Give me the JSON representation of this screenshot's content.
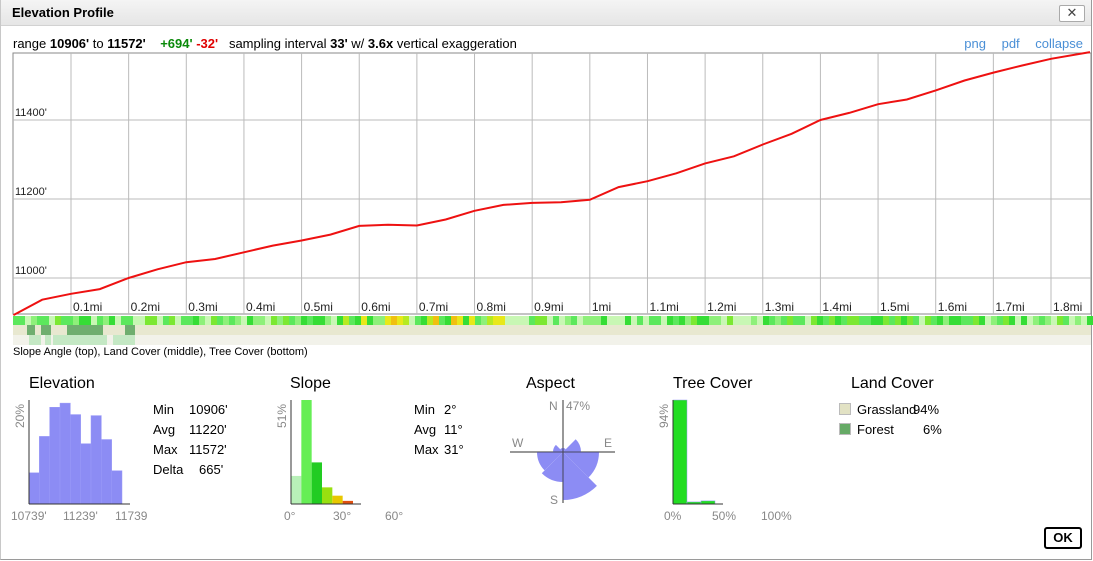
{
  "window": {
    "title": "Elevation Profile",
    "close_glyph": "✕"
  },
  "info": {
    "range_label": "range",
    "range_min": "10906'",
    "to_label": "to",
    "range_max": "11572'",
    "gain": "+694'",
    "loss": "-32'",
    "sampling_label": "sampling interval",
    "sampling_value": "33'",
    "w_label": "w/",
    "exaggeration": "3.6x",
    "exag_label": "vertical exaggeration"
  },
  "links": {
    "png": "png",
    "pdf": "pdf",
    "collapse": "collapse"
  },
  "profile": {
    "y_ticks": [
      "11400'",
      "11200'",
      "11000'"
    ],
    "x_ticks": [
      "0.1mi",
      "0.2mi",
      "0.3mi",
      "0.4mi",
      "0.5mi",
      "0.6mi",
      "0.7mi",
      "0.8mi",
      "0.9mi",
      "1mi",
      "1.1mi",
      "1.2mi",
      "1.3mi",
      "1.4mi",
      "1.5mi",
      "1.6mi",
      "1.7mi",
      "1.8mi"
    ],
    "line_color": "#ee1111",
    "distance_mi": [
      0,
      0.05,
      0.1,
      0.15,
      0.2,
      0.25,
      0.3,
      0.35,
      0.4,
      0.45,
      0.5,
      0.55,
      0.6,
      0.65,
      0.7,
      0.75,
      0.8,
      0.85,
      0.9,
      0.95,
      1.0,
      1.05,
      1.1,
      1.15,
      1.2,
      1.25,
      1.3,
      1.35,
      1.4,
      1.45,
      1.5,
      1.55,
      1.6,
      1.65,
      1.7,
      1.75,
      1.8,
      1.87
    ],
    "elevation_ft": [
      10906,
      10945,
      10960,
      10972,
      11000,
      11022,
      11040,
      11048,
      11065,
      11082,
      11095,
      11110,
      11132,
      11135,
      11133,
      11148,
      11170,
      11185,
      11190,
      11192,
      11198,
      11230,
      11245,
      11265,
      11290,
      11308,
      11338,
      11365,
      11400,
      11418,
      11440,
      11452,
      11475,
      11500,
      11520,
      11538,
      11555,
      11572
    ]
  },
  "slope_bar_caption": "Slope Angle (top), Land Cover (middle), Tree Cover (bottom)",
  "elevation_panel": {
    "title": "Elevation",
    "y_label": "20%",
    "x_ticks": [
      "10739'",
      "11239'",
      "11739"
    ],
    "bar_color": "#8c8cf4",
    "bins": [
      0.3,
      0.65,
      0.93,
      0.97,
      0.86,
      0.58,
      0.85,
      0.62,
      0.32
    ],
    "stats": [
      {
        "k": "Min",
        "v": "10906'"
      },
      {
        "k": "Avg",
        "v": "11220'"
      },
      {
        "k": "Max",
        "v": "11572'"
      },
      {
        "k": "Delta",
        "v": "665'"
      }
    ]
  },
  "slope_panel": {
    "title": "Slope",
    "y_label": "51%",
    "x_ticks": [
      "0°",
      "30°",
      "60°"
    ],
    "bins": [
      0.27,
      1.0,
      0.4,
      0.16,
      0.08,
      0.03
    ],
    "bin_colors": [
      "#b8f0b8",
      "#66ee55",
      "#22cc22",
      "#99e010",
      "#e8c800",
      "#e05010"
    ],
    "stats": [
      {
        "k": "Min",
        "v": "2°"
      },
      {
        "k": "Avg",
        "v": "11°"
      },
      {
        "k": "Max",
        "v": "31°"
      }
    ]
  },
  "aspect_panel": {
    "title": "Aspect",
    "n_label": "N",
    "pct_label": "47%",
    "e_label": "E",
    "w_label": "W",
    "s_label": "S",
    "fill_color": "#8c8cf4"
  },
  "tree_panel": {
    "title": "Tree Cover",
    "y_label": "94%",
    "x_ticks": [
      "0%",
      "50%",
      "100%"
    ],
    "bins": [
      1.0,
      0.02,
      0.03
    ],
    "bar_color": "#22dd22"
  },
  "land_panel": {
    "title": "Land Cover",
    "items": [
      {
        "name": "Grassland",
        "pct": "94%",
        "color": "#e2e2c4"
      },
      {
        "name": "Forest",
        "pct": "6%",
        "color": "#66aa66"
      }
    ]
  },
  "ok_label": "OK"
}
